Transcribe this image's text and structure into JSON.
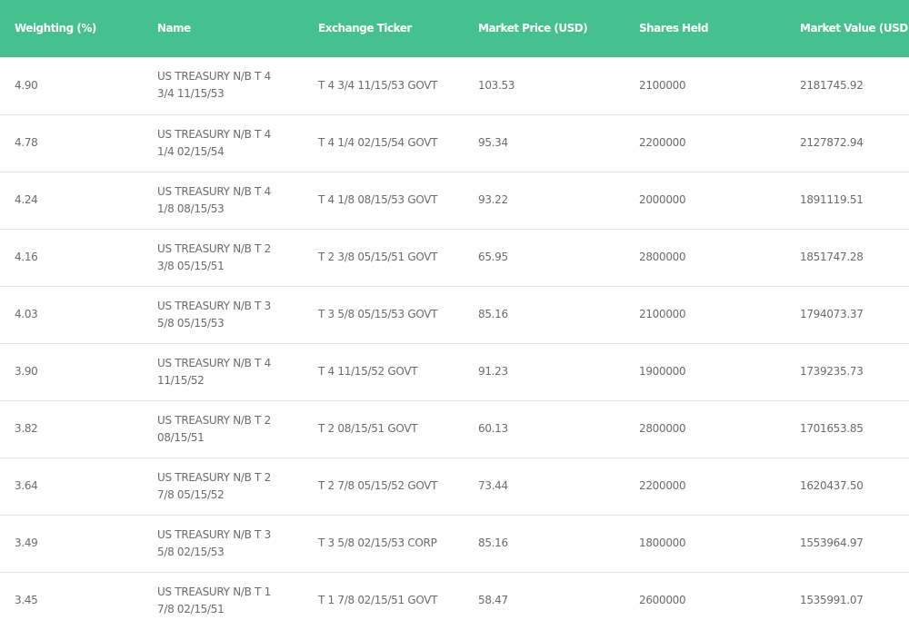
{
  "table": {
    "headers": [
      "Weighting (%)",
      "Name",
      "Exchange Ticker",
      "Market Price (USD)",
      "Shares Held",
      "Market Value (USD)"
    ],
    "rows": [
      {
        "weighting": "4.90",
        "name": "US TREASURY N/B T 4 3/4 11/15/53",
        "ticker": "T 4 3/4 11/15/53 GOVT",
        "price": "103.53",
        "shares": "2100000",
        "value": "2181745.92"
      },
      {
        "weighting": "4.78",
        "name": "US TREASURY N/B T 4 1/4 02/15/54",
        "ticker": "T 4 1/4 02/15/54 GOVT",
        "price": "95.34",
        "shares": "2200000",
        "value": "2127872.94"
      },
      {
        "weighting": "4.24",
        "name": "US TREASURY N/B T 4 1/8 08/15/53",
        "ticker": "T 4 1/8 08/15/53 GOVT",
        "price": "93.22",
        "shares": "2000000",
        "value": "1891119.51"
      },
      {
        "weighting": "4.16",
        "name": "US TREASURY N/B T 2 3/8 05/15/51",
        "ticker": "T 2 3/8 05/15/51 GOVT",
        "price": "65.95",
        "shares": "2800000",
        "value": "1851747.28"
      },
      {
        "weighting": "4.03",
        "name": "US TREASURY N/B T 3 5/8 05/15/53",
        "ticker": "T 3 5/8 05/15/53 GOVT",
        "price": "85.16",
        "shares": "2100000",
        "value": "1794073.37"
      },
      {
        "weighting": "3.90",
        "name": "US TREASURY N/B T 4 11/15/52",
        "ticker": "T 4 11/15/52 GOVT",
        "price": "91.23",
        "shares": "1900000",
        "value": "1739235.73"
      },
      {
        "weighting": "3.82",
        "name": "US TREASURY N/B T 2 08/15/51",
        "ticker": "T 2 08/15/51 GOVT",
        "price": "60.13",
        "shares": "2800000",
        "value": "1701653.85"
      },
      {
        "weighting": "3.64",
        "name": "US TREASURY N/B T 2 7/8 05/15/52",
        "ticker": "T 2 7/8 05/15/52 GOVT",
        "price": "73.44",
        "shares": "2200000",
        "value": "1620437.50"
      },
      {
        "weighting": "3.49",
        "name": "US TREASURY N/B T 3 5/8 02/15/53",
        "ticker": "T 3 5/8 02/15/53 CORP",
        "price": "85.16",
        "shares": "1800000",
        "value": "1553964.97"
      },
      {
        "weighting": "3.45",
        "name": "US TREASURY N/B T 1 7/8 02/15/51",
        "ticker": "T 1 7/8 02/15/51 GOVT",
        "price": "58.47",
        "shares": "2600000",
        "value": "1535991.07"
      }
    ]
  },
  "colors": {
    "header_bg": "#45c08f",
    "header_text": "#ffffff",
    "body_text": "#6b6b6b",
    "row_border": "#e3e3e3"
  }
}
